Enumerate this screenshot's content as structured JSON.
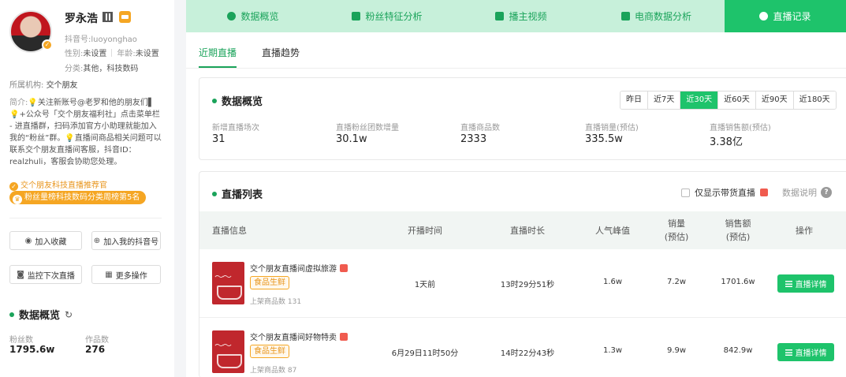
{
  "profile": {
    "name": "罗永浩",
    "douyin_id": "抖音号:luoyonghao",
    "gender_label": "性别:",
    "gender_value": "未设置",
    "age_label": "年龄:",
    "age_value": "未设置",
    "category_label": "分类:",
    "category_value": "其他，科技数码",
    "org_label": "所属机构:",
    "org_value": "交个朋友",
    "bio_label": "简介:",
    "bio_text": "💡关注新账号@老罗和他的朋友们▌💡+公众号「交个朋友福利社」点击菜单栏 - 进直播群，扫码添加官方小助理就能加入我的“粉丝”群。💡直播间商品相关问题可以联系交个朋友直播间客服，抖音ID：realzhuli，客服会协助您处理。",
    "badge_text": "交个朋友科技直播推荐官",
    "rank_text": "粉丝量榜科技数码分类周榜第5名"
  },
  "sidebar_buttons": {
    "collect": "加入收藏",
    "add_mine": "加入我的抖音号",
    "monitor": "监控下次直播",
    "more": "更多操作"
  },
  "side_overview": {
    "title": "数据概览",
    "fans_label": "粉丝数",
    "fans_value": "1795.6w",
    "works_label": "作品数",
    "works_value": "276"
  },
  "nav": {
    "tabs": [
      {
        "label": "数据概览"
      },
      {
        "label": "粉丝特征分析"
      },
      {
        "label": "播主视频"
      },
      {
        "label": "电商数据分析"
      },
      {
        "label": "直播记录"
      }
    ]
  },
  "subtabs": [
    "近期直播",
    "直播趋势"
  ],
  "overview": {
    "title": "数据概览",
    "ranges": [
      "昨日",
      "近7天",
      "近30天",
      "近60天",
      "近90天",
      "近180天"
    ],
    "active_range": "近30天",
    "stats": [
      {
        "label": "新增直播场次",
        "value": "31"
      },
      {
        "label": "直播粉丝团数增量",
        "value": "30.1w"
      },
      {
        "label": "直播商品数",
        "value": "2333"
      },
      {
        "label": "直播销量(预估)",
        "value": "335.5w"
      },
      {
        "label": "直播销售额(预估)",
        "value": "3.38亿"
      }
    ]
  },
  "live_list": {
    "title": "直播列表",
    "filter_label": "仅显示带货直播",
    "help_label": "数据说明",
    "columns": {
      "info": "直播信息",
      "start": "开播时间",
      "duration": "直播时长",
      "peak": "人气峰值",
      "sales_1": "销量",
      "sales_2": "(预估)",
      "revenue_1": "销售额",
      "revenue_2": "(预估)",
      "action": "操作"
    },
    "detail_label": "直播详情",
    "rows": [
      {
        "title": "交个朋友直播间虚拟旅游",
        "tag": "食品生鲜",
        "goods": "上架商品数 131",
        "start": "1天前",
        "duration": "13时29分51秒",
        "peak": "1.6w",
        "sales": "7.2w",
        "revenue": "1701.6w"
      },
      {
        "title": "交个朋友直播间好物特卖",
        "tag": "食品生鲜",
        "goods": "上架商品数 87",
        "start": "6月29日11时50分",
        "duration": "14时22分43秒",
        "peak": "1.3w",
        "sales": "9.9w",
        "revenue": "842.9w"
      }
    ]
  },
  "colors": {
    "accent": "#1ec36b",
    "nav_bg": "#c7f0da",
    "badge_orange": "#f5a623"
  }
}
